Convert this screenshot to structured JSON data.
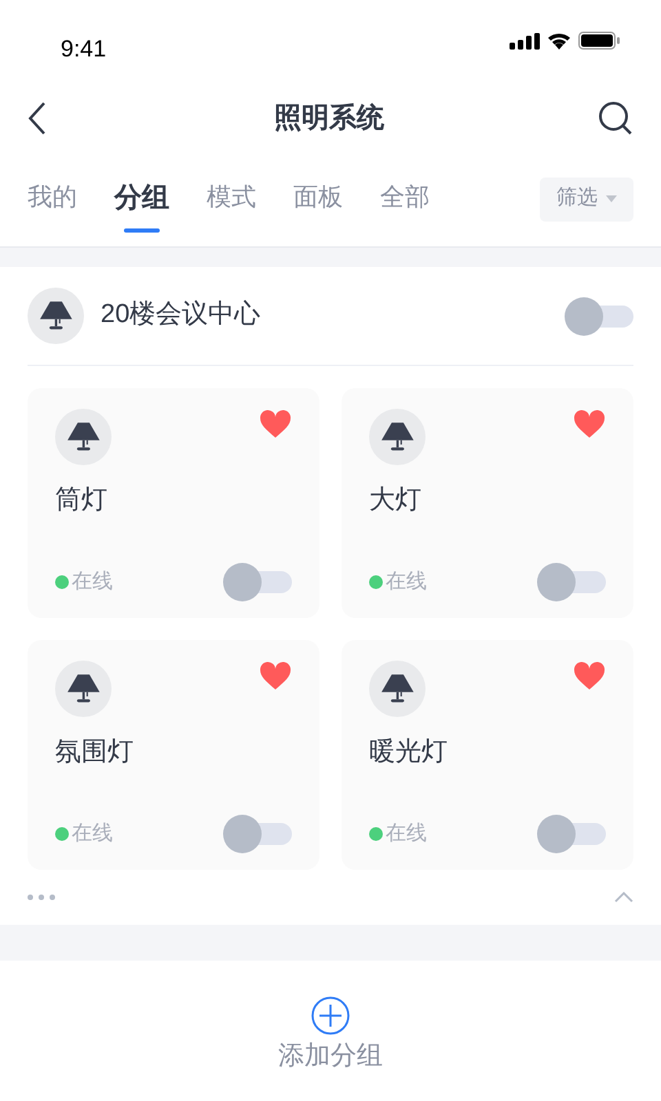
{
  "status_bar": {
    "time": "9:41"
  },
  "nav": {
    "title": "照明系统"
  },
  "tabs": [
    {
      "label": "我的",
      "selected": false
    },
    {
      "label": "分组",
      "selected": true
    },
    {
      "label": "模式",
      "selected": false
    },
    {
      "label": "面板",
      "selected": false
    },
    {
      "label": "全部",
      "selected": false
    }
  ],
  "filter": {
    "label": "筛选"
  },
  "group": {
    "name": "20楼会议中心",
    "on": false,
    "expanded": true,
    "devices": [
      {
        "name": "筒灯",
        "favorite": true,
        "online": true,
        "status": "在线",
        "on": false
      },
      {
        "name": "大灯",
        "favorite": true,
        "online": true,
        "status": "在线",
        "on": false
      },
      {
        "name": "氛围灯",
        "favorite": true,
        "online": true,
        "status": "在线",
        "on": false
      },
      {
        "name": "暖光灯",
        "favorite": true,
        "online": true,
        "status": "在线",
        "on": false
      }
    ]
  },
  "add_group": {
    "label": "添加分组"
  }
}
